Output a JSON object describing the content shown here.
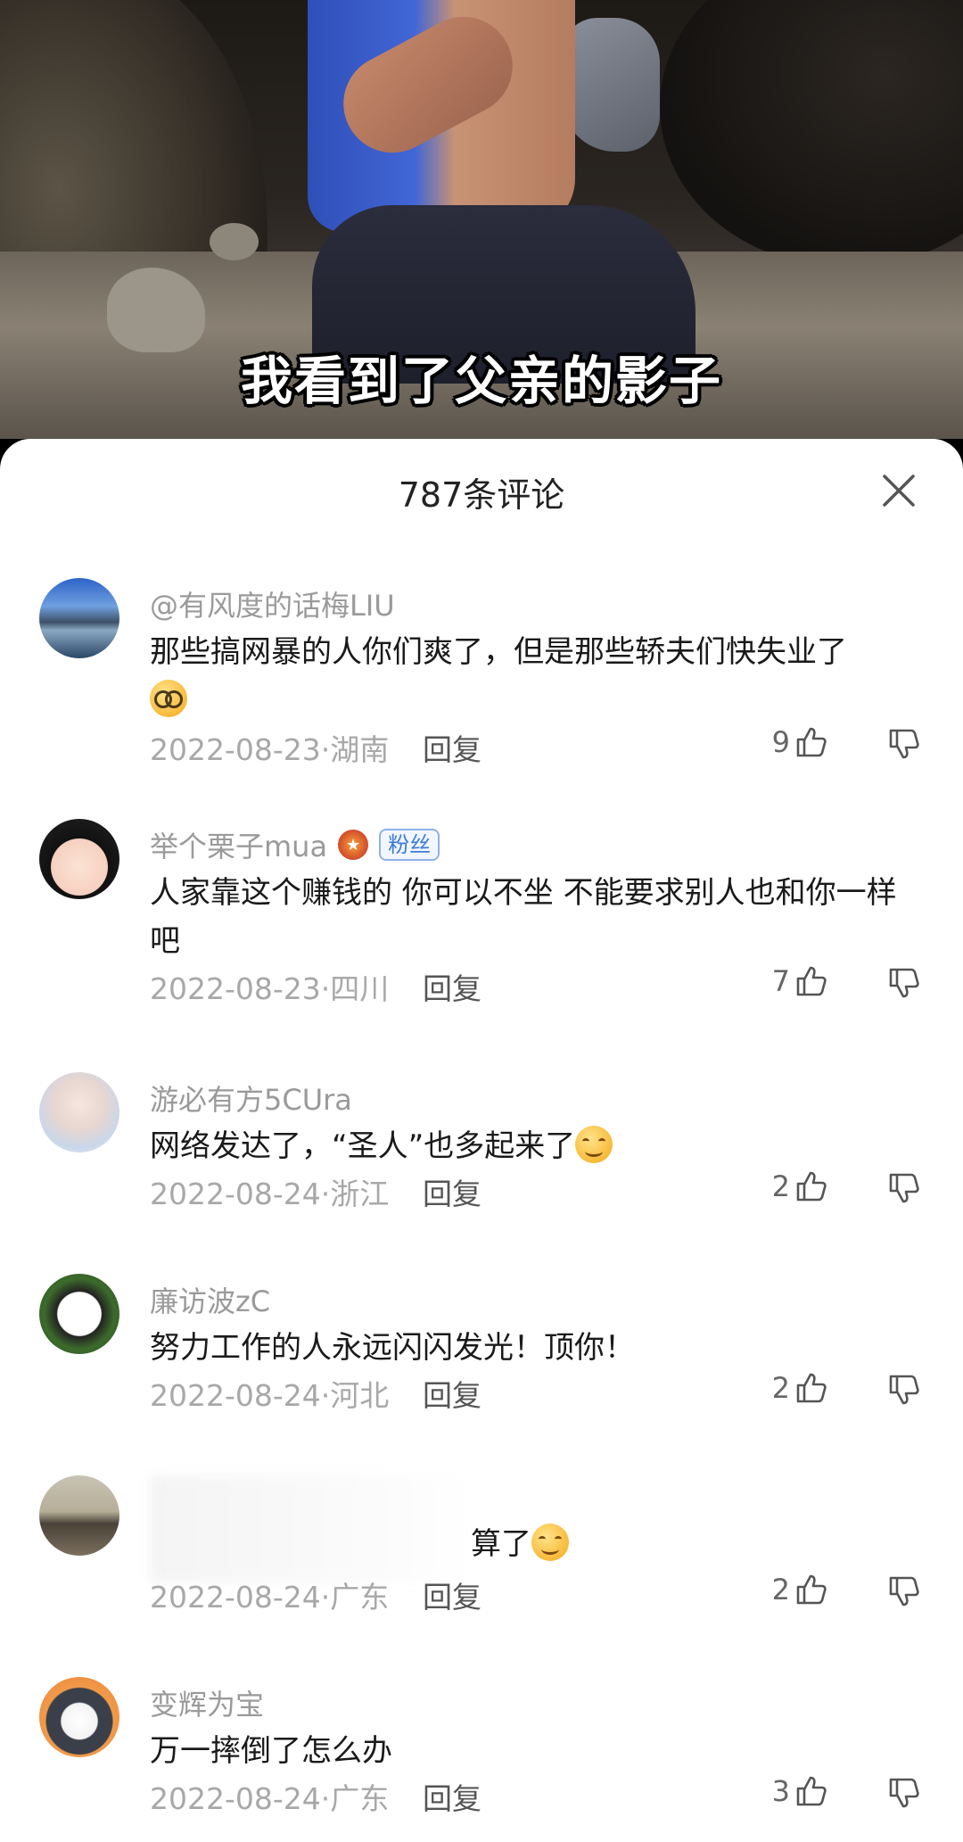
{
  "video": {
    "subtitle": "我看到了父亲的影子"
  },
  "comments_panel": {
    "title": "787条评论",
    "close_icon": "close-icon",
    "reply_label": "回复",
    "comments": [
      {
        "username": "@有风度的话梅LIU",
        "text": "那些搞网暴的人你们爽了，但是那些轿夫们快失业了",
        "emoji": "glasses-emoji",
        "meta": "2022-08-23·湖南",
        "likes": "9"
      },
      {
        "username": "举个栗子mua",
        "badge": "粉丝",
        "text": "人家靠这个赚钱的 你可以不坐 不能要求别人也和你一样吧",
        "meta": "2022-08-23·四川",
        "likes": "7"
      },
      {
        "username": "游必有方5CUra",
        "text": "网络发达了，“圣人”也多起来了",
        "emoji": "smile-emoji",
        "meta": "2022-08-24·浙江",
        "likes": "2"
      },
      {
        "username": "廉访波zC",
        "text": "努力工作的人永远闪闪发光！顶你！",
        "meta": "2022-08-24·河北",
        "likes": "2"
      },
      {
        "username": "",
        "text": "算了",
        "emoji": "smile-emoji",
        "meta": "2022-08-24·广东",
        "likes": "2"
      },
      {
        "username": "变辉为宝",
        "text": "万一摔倒了怎么办",
        "meta": "2022-08-24·广东",
        "likes": "3"
      }
    ]
  },
  "colors": {
    "sheet_bg": "#ffffff",
    "username": "#9a9a9a",
    "meta": "#a8a8a8",
    "badge_blue": "#3b7bd9"
  }
}
